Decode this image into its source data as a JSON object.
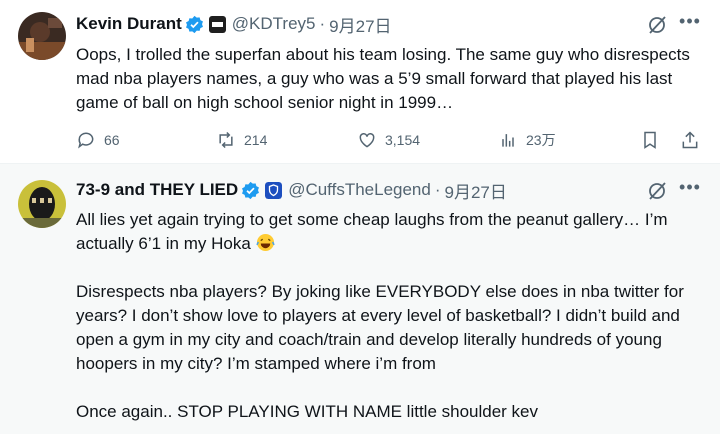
{
  "tweets": [
    {
      "name": "Kevin Durant",
      "handle": "@KDTrey5",
      "separator": "·",
      "date": "9月27日",
      "text": [
        "Oops, I trolled the superfan about his team losing. The same guy who disrespects mad nba players names, a guy who was a 5’9 small forward that played his last game of ball on high school senior night in 1999…"
      ],
      "stats": {
        "replies": "66",
        "reposts": "214",
        "likes": "3,154",
        "views": "23万"
      },
      "icons": [
        "verified-badge-icon",
        "affiliate-badge-icon",
        "grok-icon",
        "more-icon",
        "reply-icon",
        "repost-icon",
        "like-icon",
        "views-icon",
        "bookmark-icon",
        "share-icon"
      ]
    },
    {
      "name": "73-9 and THEY LIED",
      "handle": "@CuffsTheLegend",
      "separator": "·",
      "date": "9月27日",
      "text_line1": "All lies yet again trying to get some cheap laughs from the peanut gallery… I’m actually 6’1 in my Hoka",
      "text_para2": "Disrespects nba players? By joking like EVERYBODY else does in nba twitter for years? I don’t show love to players at every level of basketball? I didn’t build and open a gym in my city and coach/train and develop literally hundreds of young hoopers in my city? I’m stamped where i’m from",
      "text_para3": "Once again.. STOP PLAYING WITH NAME little shoulder kev",
      "icons": [
        "verified-badge-icon",
        "shield-badge-icon",
        "grok-icon",
        "more-icon",
        "laughing-emoji-icon"
      ]
    }
  ],
  "colors": {
    "verified_blue": "#1d9bf0",
    "muted_text": "#536471",
    "text": "#0f1419",
    "reply_bg": "#f7f9f9"
  }
}
